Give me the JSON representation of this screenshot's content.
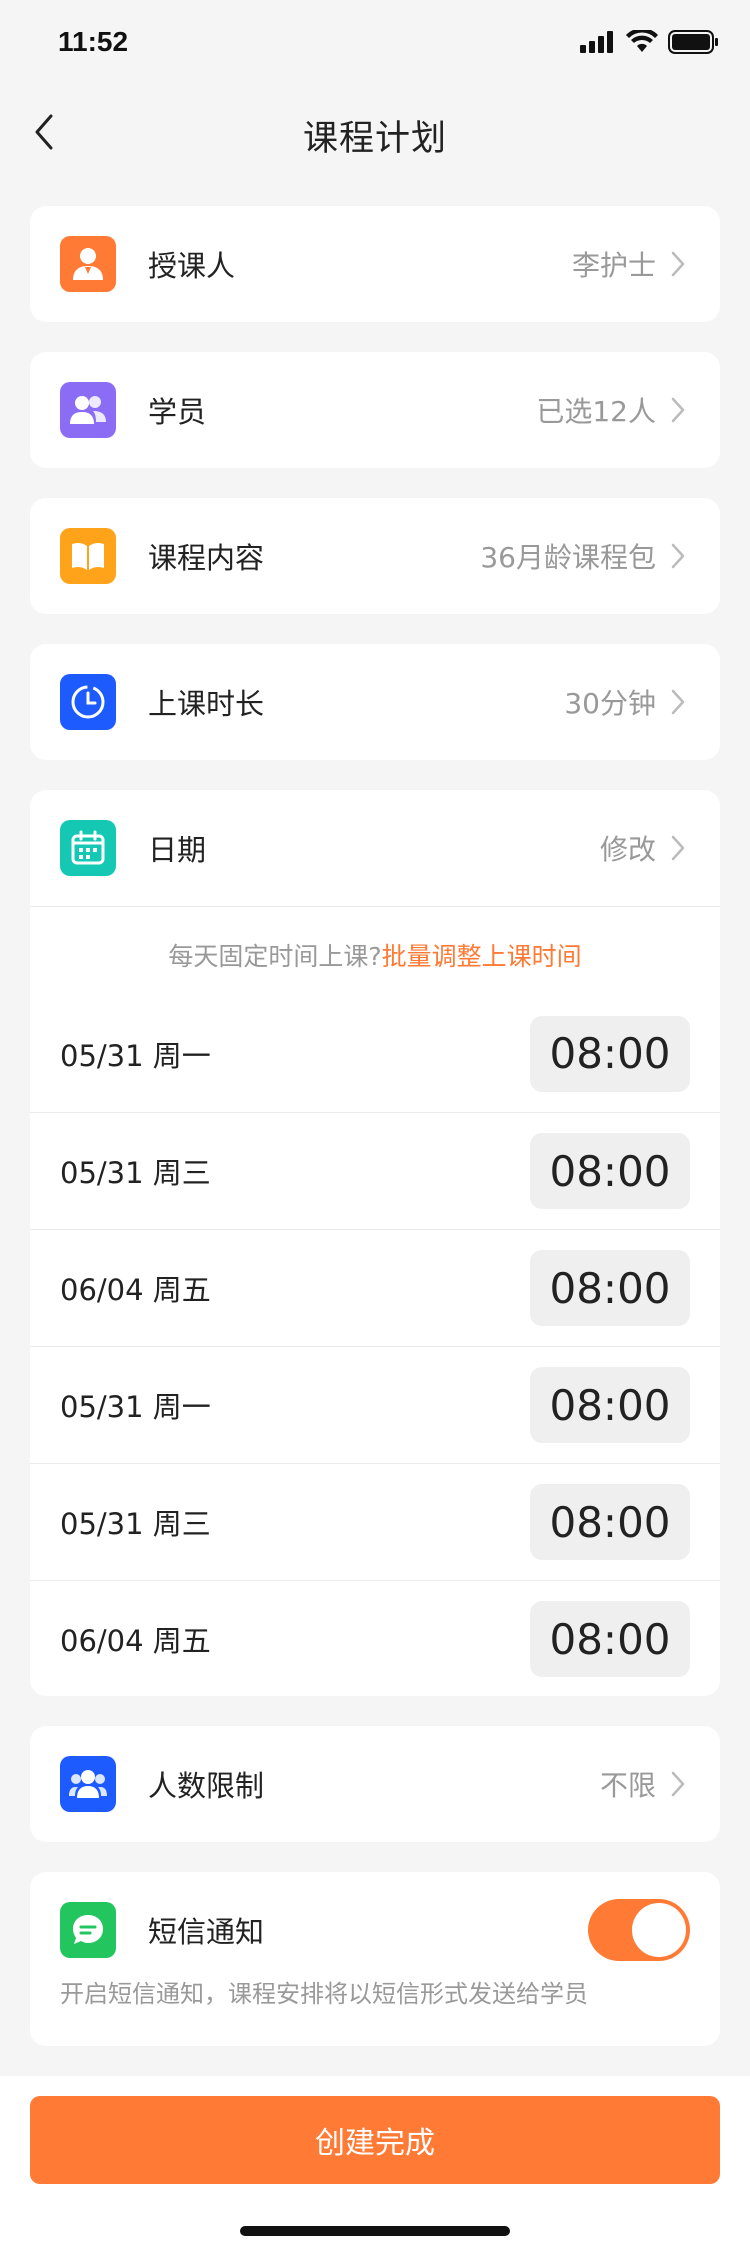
{
  "status_bar": {
    "time": "11:52",
    "icons": [
      "signal-icon",
      "wifi-icon",
      "battery-icon"
    ]
  },
  "nav": {
    "title": "课程计划",
    "back_icon": "chevron-left-icon"
  },
  "rows": {
    "teacher": {
      "label": "授课人",
      "value": "李护士",
      "icon": "person-icon",
      "color": "#ff7a35"
    },
    "students": {
      "label": "学员",
      "value": "已选12人",
      "icon": "group-icon",
      "color": "#8b6cf5"
    },
    "content": {
      "label": "课程内容",
      "value": "36月龄课程包",
      "icon": "book-icon",
      "color": "#ffa31a"
    },
    "duration": {
      "label": "上课时长",
      "value": "30分钟",
      "icon": "clock-icon",
      "color": "#1e5bff"
    },
    "date": {
      "label": "日期",
      "value": "修改",
      "icon": "calendar-icon",
      "color": "#14c8b4"
    }
  },
  "schedule": {
    "hint_prefix": "每天固定时间上课?",
    "hint_link": "批量调整上课时间",
    "items": [
      {
        "date": "05/31 周一",
        "time": "08:00"
      },
      {
        "date": "05/31 周三",
        "time": "08:00"
      },
      {
        "date": "06/04 周五",
        "time": "08:00"
      },
      {
        "date": "05/31 周一",
        "time": "08:00"
      },
      {
        "date": "05/31 周三",
        "time": "08:00"
      },
      {
        "date": "06/04 周五",
        "time": "08:00"
      }
    ]
  },
  "limit": {
    "label": "人数限制",
    "value": "不限",
    "icon": "people-icon",
    "color": "#1e5bff"
  },
  "sms": {
    "label": "短信通知",
    "description": "开启短信通知，课程安排将以短信形式发送给学员",
    "enabled": true,
    "icon": "message-icon",
    "color": "#22c55e"
  },
  "footer": {
    "button_label": "创建完成"
  },
  "colors": {
    "accent": "#ff7a35",
    "background": "#f5f5f5"
  }
}
